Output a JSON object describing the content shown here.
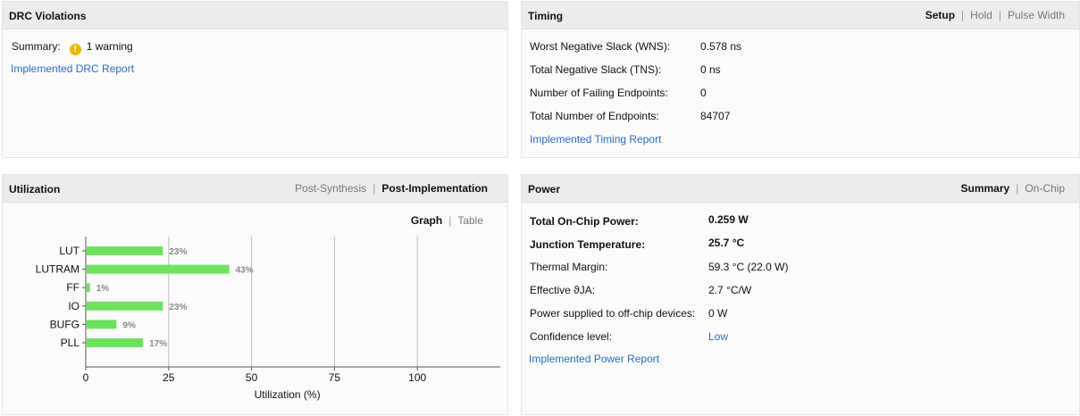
{
  "drc": {
    "title": "DRC Violations",
    "summary_label": "Summary:",
    "summary_value": "1 warning",
    "report_link": "Implemented DRC Report"
  },
  "timing": {
    "title": "Timing",
    "tabs": [
      "Setup",
      "Hold",
      "Pulse Width"
    ],
    "active_tab": "Setup",
    "rows": [
      {
        "label": "Worst Negative Slack (WNS):",
        "value": "0.578 ns"
      },
      {
        "label": "Total Negative Slack (TNS):",
        "value": "0 ns"
      },
      {
        "label": "Number of Failing Endpoints:",
        "value": "0"
      },
      {
        "label": "Total Number of Endpoints:",
        "value": "84707"
      }
    ],
    "report_link": "Implemented Timing Report"
  },
  "utilization": {
    "title": "Utilization",
    "tabs": [
      "Post-Synthesis",
      "Post-Implementation"
    ],
    "active_tab": "Post-Implementation",
    "view_tabs": [
      "Graph",
      "Table"
    ],
    "active_view": "Graph"
  },
  "chart_data": {
    "type": "bar",
    "orientation": "horizontal",
    "categories": [
      "LUT",
      "LUTRAM",
      "FF",
      "IO",
      "BUFG",
      "PLL"
    ],
    "values": [
      23,
      43,
      1,
      23,
      9,
      17
    ],
    "value_labels": [
      "23%",
      "43%",
      "1%",
      "23%",
      "9%",
      "17%"
    ],
    "xlabel": "Utilization (%)",
    "ylabel": "",
    "xlim": [
      0,
      125
    ],
    "xticks": [
      0,
      25,
      50,
      75,
      100
    ],
    "grid": true,
    "bar_color": "#6ee25f"
  },
  "power": {
    "title": "Power",
    "tabs": [
      "Summary",
      "On-Chip"
    ],
    "active_tab": "Summary",
    "rows": [
      {
        "label": "Total On-Chip Power:",
        "value": "0.259 W",
        "bold": true
      },
      {
        "label": "Junction Temperature:",
        "value": "25.7 °C",
        "bold": true
      },
      {
        "label": "Thermal Margin:",
        "value": "59.3 °C (22.0 W)",
        "bold": false
      },
      {
        "label": "Effective ϑJA:",
        "value": "2.7 °C/W",
        "bold": false
      },
      {
        "label": "Power supplied to off-chip devices:",
        "value": "0 W",
        "bold": false
      },
      {
        "label": "Confidence level:",
        "value": "Low",
        "bold": false,
        "link": true
      }
    ],
    "report_link": "Implemented Power Report"
  },
  "colors": {
    "link": "#2a6cc8",
    "warning": "#e8b800",
    "header_bg": "#ececec"
  }
}
